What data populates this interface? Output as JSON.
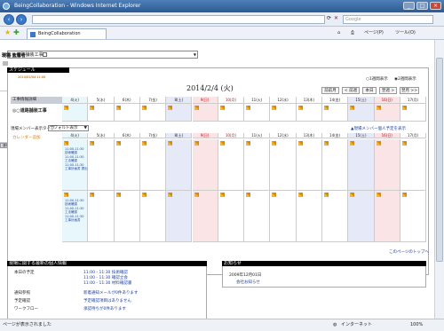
{
  "window": {
    "title": "BeingCollaboration - Windows Internet Explorer"
  },
  "browser": {
    "search_placeholder": "Google",
    "tab_label": "BeingCollaboration",
    "tools": [
      "ページ(P)",
      "ツール(O)"
    ]
  },
  "status": {
    "text": "ページが表示されました",
    "zone": "インターネット",
    "zoom": "100%"
  },
  "project": {
    "select": "：：道路舗装工事"
  },
  "schedule": {
    "heading": "スケジュール",
    "date": "2014/2/4 (火)",
    "view_1": "1週間表示",
    "view_2": "2週間表示",
    "nav": [
      "前前月",
      "< 前週",
      "本日",
      "翌週 >",
      "翌月 >>"
    ],
    "project_label": "工事情報詳細",
    "project_name": "◎○道路舗装工事",
    "member_label": "現場メンバー表示タイプ",
    "member_select": "デフォルト表示",
    "member_link": "現場メンバー個人予定を表示",
    "calendar_link": "カレンダー追加",
    "days": [
      "4(火)",
      "5(水)",
      "6(木)",
      "7(金)",
      "8(土)",
      "9(日)",
      "10(月)",
      "11(火)",
      "12(水)",
      "13(木)",
      "14(金)",
      "15(土)",
      "16(日)",
      "17(月)"
    ],
    "members": [
      {
        "role": "現場",
        "name": "監督者",
        "date": "2014/02/04 11:00",
        "events": [
          "11:00-11:30 技術確認",
          "11:00-11:30 工法確認",
          "11:00-11:30 工事計画書 提出"
        ]
      },
      {
        "role": "現場",
        "name": "大塚",
        "date": "2014/02/04 11:00",
        "events": [
          "11:00-11:30 技術確認",
          "11:00-11:30 工法確認",
          "11:00-11:30 工事計画書"
        ]
      }
    ],
    "bar_label": "通常業務",
    "page_top": "このページのトップへ"
  },
  "info": {
    "heading": "現場に関する最新の個人情報",
    "rows": [
      {
        "label": "本日の予定",
        "values": [
          "11:00 - 11:30 技術確認",
          "11:00 - 11:30 確認立会",
          "11:00 - 11:30 材料確認書"
        ]
      },
      {
        "label": "通知参照",
        "values": [
          "新着通知メールが0件あります"
        ]
      },
      {
        "label": "予定確認",
        "values": [
          "予定確認項目はありません"
        ]
      },
      {
        "label": "ワークフロー",
        "values": [
          "承認待ちが0件あります"
        ]
      }
    ]
  },
  "notice": {
    "heading": "お知らせ",
    "date": "2009年12月01日",
    "link": "会社お知らせ"
  }
}
